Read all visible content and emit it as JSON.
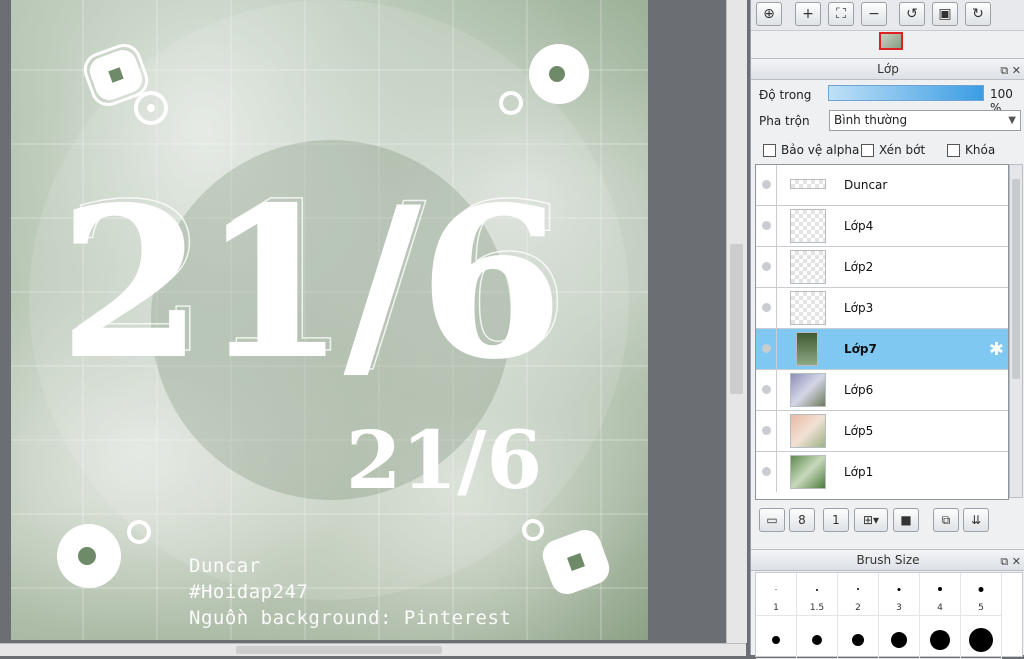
{
  "canvas": {
    "big_date": "21/6",
    "small_date": "21/6",
    "caption_lines": [
      "Duncar",
      "#Hoidap247",
      "Nguồn background: Pinterest"
    ]
  },
  "toolbar": {
    "icons": [
      "zoom-fit-icon",
      "zoom-in-icon",
      "fit-screen-icon",
      "zoom-out-icon",
      "rotate-left-icon",
      "actual-size-icon",
      "rotate-right-icon"
    ]
  },
  "layer_panel": {
    "title": "Lớp",
    "opacity_label": "Độ trong",
    "opacity_value": "100 %",
    "opacity": 1.0,
    "blend_label": "Pha trộn",
    "blend_value": "Bình thường",
    "checkboxes": [
      "Bảo vệ alpha",
      "Xén bớt",
      "Khóa"
    ],
    "layers": [
      {
        "name": "Duncar",
        "selected": false
      },
      {
        "name": "Lớp4",
        "selected": false
      },
      {
        "name": "Lớp2",
        "selected": false
      },
      {
        "name": "Lớp3",
        "selected": false
      },
      {
        "name": "Lớp7",
        "selected": true
      },
      {
        "name": "Lớp6",
        "selected": false
      },
      {
        "name": "Lớp5",
        "selected": false
      },
      {
        "name": "Lớp1",
        "selected": false
      }
    ]
  },
  "brush_panel": {
    "title": "Brush Size",
    "sizes": [
      "1",
      "1.5",
      "2",
      "3",
      "4",
      "5"
    ]
  },
  "colors": {
    "selected_layer": "#7fc8f2",
    "opacity_bar": "#3b9de3",
    "nav_highlight": "#dd2222"
  }
}
